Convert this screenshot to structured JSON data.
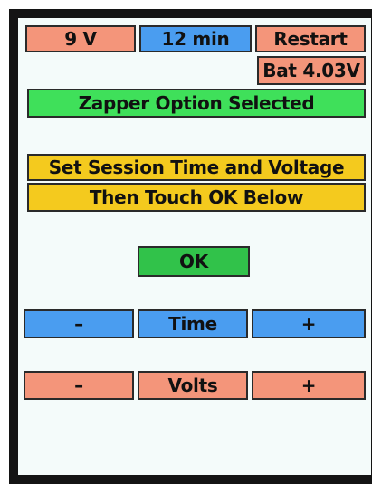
{
  "top_bar": {
    "voltage": "9 V",
    "time": "12 min",
    "restart": "Restart",
    "battery": "Bat 4.03V"
  },
  "banner": "Zapper Option Selected",
  "instructions": {
    "line1": "Set Session Time and Voltage",
    "line2": "Then Touch OK Below"
  },
  "ok_label": "OK",
  "time_row": {
    "minus": "–",
    "label": "Time",
    "plus": "+"
  },
  "volts_row": {
    "minus": "–",
    "label": "Volts",
    "plus": "+"
  },
  "colors": {
    "screen": "#f4fbfa",
    "salmon": "#f4957a",
    "blue": "#4a9df0",
    "green": "#3fe05a",
    "gold": "#f4ca1e",
    "bezel": "#141414"
  }
}
